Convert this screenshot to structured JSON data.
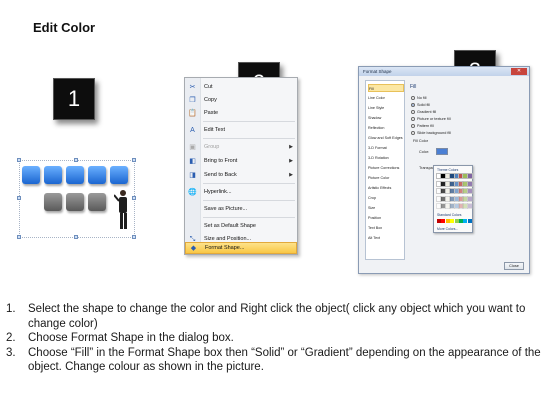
{
  "title": "Edit Color",
  "badges": [
    "1",
    "2",
    "3"
  ],
  "context_menu": {
    "items": [
      {
        "label": "Cut",
        "icon": "scissors-icon",
        "glyph": "✂"
      },
      {
        "label": "Copy",
        "icon": "copy-icon",
        "glyph": "❐"
      },
      {
        "label": "Paste",
        "icon": "paste-icon",
        "glyph": "📋"
      },
      {
        "label": "Edit Text",
        "icon": "edit-text-icon",
        "glyph": "A"
      },
      {
        "label": "Group",
        "icon": "group-icon",
        "glyph": "▣"
      },
      {
        "label": "Bring to Front",
        "icon": "bring-front-icon",
        "glyph": "◧"
      },
      {
        "label": "Send to Back",
        "icon": "send-back-icon",
        "glyph": "◨"
      },
      {
        "label": "Hyperlink...",
        "icon": "hyperlink-icon",
        "glyph": "🌐"
      },
      {
        "label": "Save as Picture...",
        "icon": "",
        "glyph": ""
      },
      {
        "label": "Set as Default Shape",
        "icon": "",
        "glyph": ""
      },
      {
        "label": "Size and Position...",
        "icon": "size-position-icon",
        "glyph": "⤡"
      },
      {
        "label": "Format Shape...",
        "icon": "format-shape-icon",
        "glyph": "◆"
      }
    ]
  },
  "dialog": {
    "title": "Format Shape",
    "close": "✕",
    "categories": [
      "Fill",
      "Line Color",
      "Line Style",
      "Shadow",
      "Reflection",
      "Glow and Soft Edges",
      "3-D Format",
      "3-D Rotation",
      "Picture Corrections",
      "Picture Color",
      "Artistic Effects",
      "Crop",
      "Size",
      "Position",
      "Text Box",
      "Alt Text"
    ],
    "section_heading": "Fill",
    "fill_options": [
      "No fill",
      "Solid fill",
      "Gradient fill",
      "Picture or texture fill",
      "Pattern fill",
      "Slide background fill"
    ],
    "fill_color_label": "Fill Color",
    "color_label": "Color:",
    "transparency_label": "Transparency:",
    "theme_colors_label": "Theme Colors",
    "standard_colors_label": "Standard Colors",
    "more_colors_label": "More Colors...",
    "close_button": "Close"
  },
  "instructions": [
    {
      "num": "1.",
      "text": "Select the shape to change the color and Right click the object( click any object which you want to change color)"
    },
    {
      "num": "2.",
      "text": "Choose Format Shape in the dialog box."
    },
    {
      "num": "3.",
      "text": "Choose “Fill” in the Format Shape box then “Solid” or “Gradient” depending on the appearance of the object. Change colour as shown in the picture."
    }
  ],
  "colors": {
    "badge_bg": "#0d0d0d",
    "blue_box": "#2f7be0",
    "gray_box": "#6e6e6e",
    "menu_highlight": "#f9c744",
    "dialog_border": "#8a9bb4"
  }
}
